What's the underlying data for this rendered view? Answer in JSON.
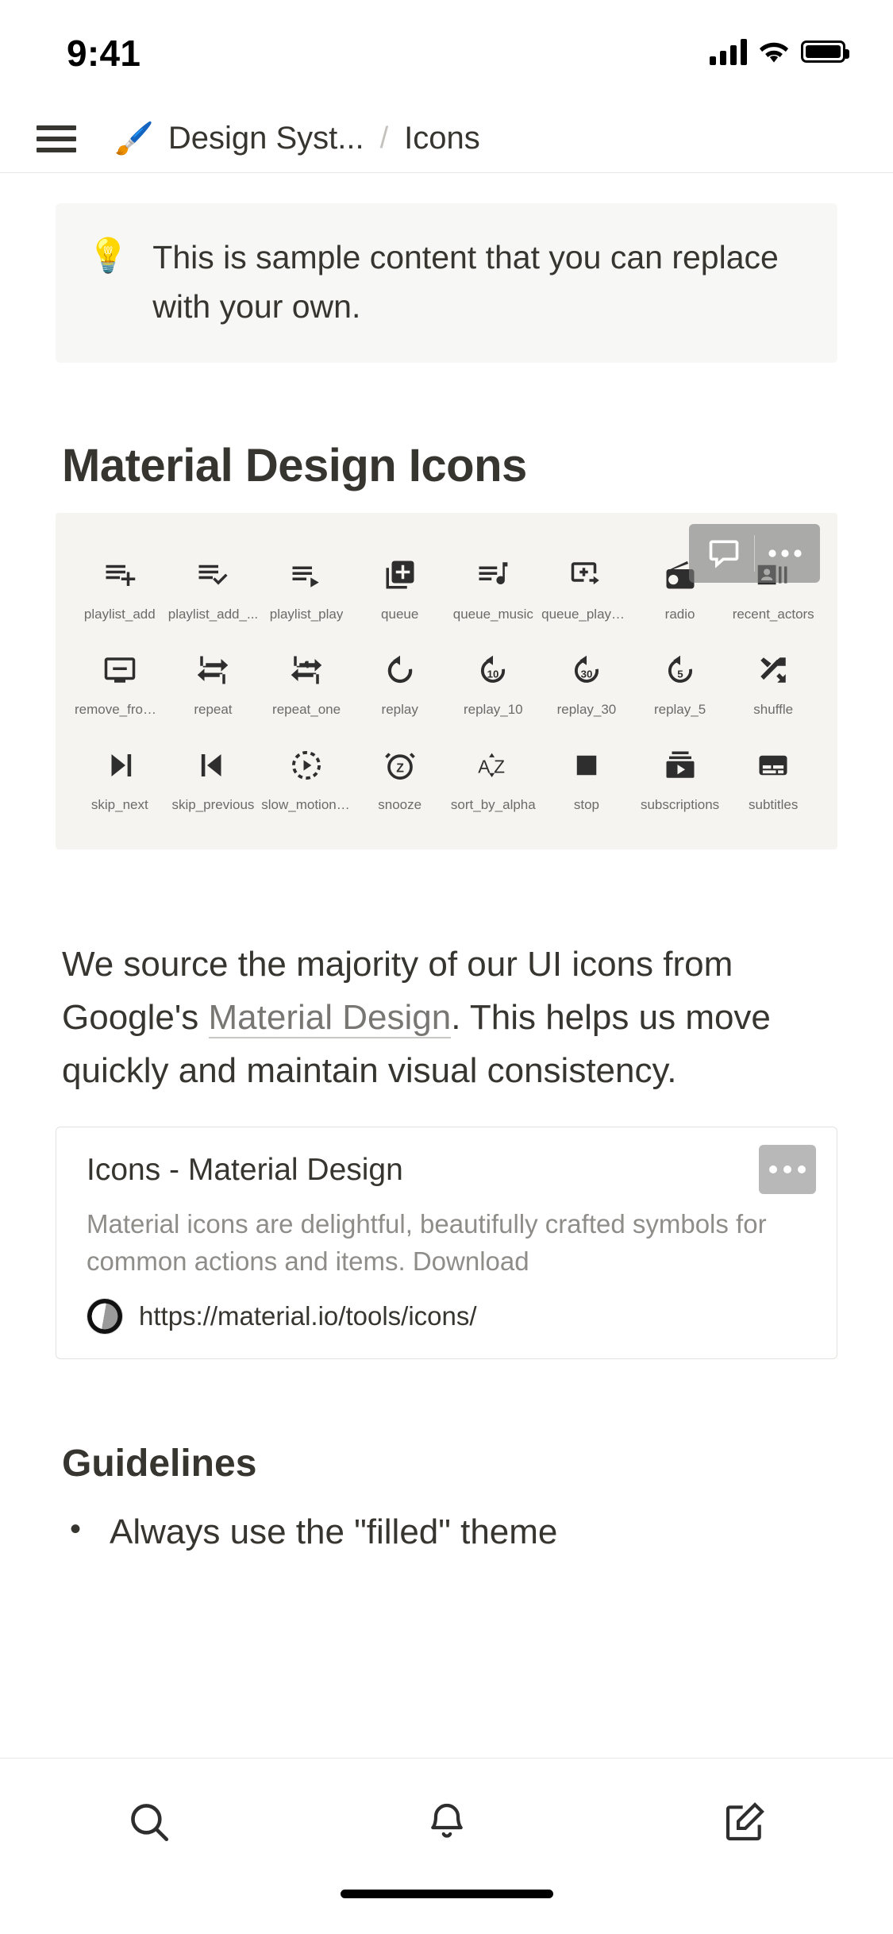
{
  "status_bar": {
    "time": "9:41",
    "signal_icon": "cellular-signal-icon",
    "wifi_icon": "wifi-icon",
    "battery_icon": "battery-full-icon"
  },
  "header": {
    "menu_icon": "hamburger-menu-icon",
    "page_emoji": "🖌️",
    "breadcrumb_parent": "Design Syst...",
    "breadcrumb_separator": "/",
    "breadcrumb_current": "Icons"
  },
  "callout": {
    "emoji": "💡",
    "text": "This is sample content that you can replace with your own."
  },
  "main": {
    "heading": "Material Design Icons",
    "paragraph_before_link": "We source the majority of our UI icons from Google's ",
    "link_text": "Material Design",
    "paragraph_after_link": ". This helps us move quickly and maintain visual consistency.",
    "guidelines_heading": "Guidelines",
    "guidelines_items": [
      {
        "bullet": "•",
        "text": "Always use the \"filled\" theme"
      }
    ]
  },
  "icon_grid": {
    "hover_toolbar": {
      "comment_icon": "comment-bubble-icon",
      "more_icon": "more-options-icon"
    },
    "rows": [
      [
        {
          "name": "playlist_add",
          "icon": "playlist-add-icon"
        },
        {
          "name": "playlist_add_...",
          "icon": "playlist-add-check-icon"
        },
        {
          "name": "playlist_play",
          "icon": "playlist-play-icon"
        },
        {
          "name": "queue",
          "icon": "queue-icon"
        },
        {
          "name": "queue_music",
          "icon": "queue-music-icon"
        },
        {
          "name": "queue_play_ne...",
          "icon": "queue-play-next-icon"
        },
        {
          "name": "radio",
          "icon": "radio-icon"
        },
        {
          "name": "recent_actors",
          "icon": "recent-actors-icon"
        }
      ],
      [
        {
          "name": "remove_from_q...",
          "icon": "remove-from-queue-icon"
        },
        {
          "name": "repeat",
          "icon": "repeat-icon"
        },
        {
          "name": "repeat_one",
          "icon": "repeat-one-icon"
        },
        {
          "name": "replay",
          "icon": "replay-icon"
        },
        {
          "name": "replay_10",
          "icon": "replay-10-icon"
        },
        {
          "name": "replay_30",
          "icon": "replay-30-icon"
        },
        {
          "name": "replay_5",
          "icon": "replay-5-icon"
        },
        {
          "name": "shuffle",
          "icon": "shuffle-icon"
        }
      ],
      [
        {
          "name": "skip_next",
          "icon": "skip-next-icon"
        },
        {
          "name": "skip_previous",
          "icon": "skip-previous-icon"
        },
        {
          "name": "slow_motion_v...",
          "icon": "slow-motion-video-icon"
        },
        {
          "name": "snooze",
          "icon": "snooze-icon"
        },
        {
          "name": "sort_by_alpha",
          "icon": "sort-by-alpha-icon"
        },
        {
          "name": "stop",
          "icon": "stop-icon"
        },
        {
          "name": "subscriptions",
          "icon": "subscriptions-icon"
        },
        {
          "name": "subtitles",
          "icon": "subtitles-icon"
        }
      ]
    ]
  },
  "bookmark": {
    "title": "Icons - Material Design",
    "description": "Material icons are delightful, beautifully crafted symbols for common actions and items. Download",
    "url": "https://material.io/tools/icons/",
    "favicon": "material-io-favicon",
    "more_icon": "more-options-icon"
  },
  "tab_bar": {
    "tabs": [
      {
        "icon": "search-icon"
      },
      {
        "icon": "bell-notification-icon"
      },
      {
        "icon": "compose-edit-icon"
      }
    ]
  },
  "colors": {
    "text": "#37352f",
    "muted": "#8e8d89",
    "callout_bg": "#f7f7f5",
    "grid_bg": "#f5f4f0",
    "border": "#e8e8e8"
  }
}
